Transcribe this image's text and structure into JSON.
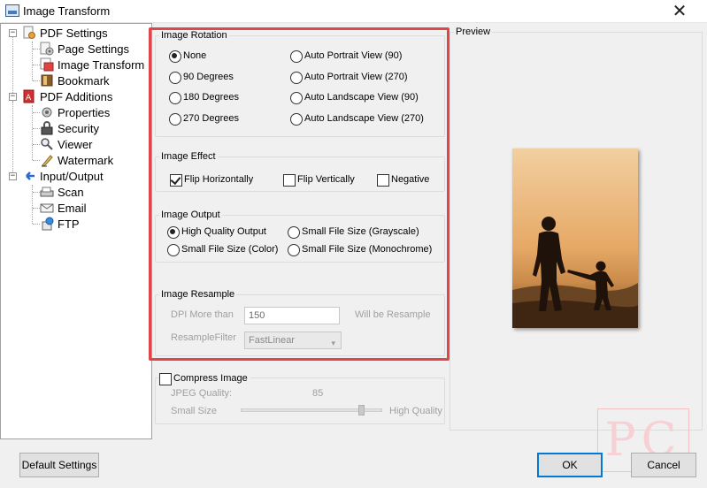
{
  "window": {
    "title": "Image Transform",
    "close_glyph": "✕"
  },
  "tree": {
    "pdf_settings": "PDF Settings",
    "page_settings": "Page Settings",
    "image_transform": "Image Transform",
    "bookmark": "Bookmark",
    "pdf_additions": "PDF Additions",
    "properties": "Properties",
    "security": "Security",
    "viewer": "Viewer",
    "watermark": "Watermark",
    "input_output": "Input/Output",
    "scan": "Scan",
    "email": "Email",
    "ftp": "FTP",
    "collapse_glyph": "−"
  },
  "rotation": {
    "label": "Image Rotation",
    "none": "None",
    "deg90": "90 Degrees",
    "deg180": "180 Degrees",
    "deg270": "270 Degrees",
    "auto_portrait_90": "Auto Portrait View (90)",
    "auto_portrait_270": "Auto Portrait View (270)",
    "auto_landscape_90": "Auto Landscape View (90)",
    "auto_landscape_270": "Auto Landscape View (270)",
    "selected": "None"
  },
  "effect": {
    "label": "Image Effect",
    "flip_h": "Flip Horizontally",
    "flip_v": "Flip Vertically",
    "negative": "Negative",
    "flip_h_checked": true,
    "flip_v_checked": false,
    "negative_checked": false
  },
  "output": {
    "label": "Image Output",
    "high_quality": "High Quality Output",
    "small_color": "Small File Size (Color)",
    "small_gray": "Small File Size (Grayscale)",
    "small_mono": "Small File Size (Monochrome)",
    "selected": "High Quality Output"
  },
  "resample": {
    "label": "Image Resample",
    "dpi_label": "DPI More than",
    "dpi_value": "150",
    "will_be": "Will be Resample",
    "filter_label": "ResampleFilter",
    "filter_value": "FastLinear",
    "arrow": "▾"
  },
  "compress": {
    "label": "Compress Image",
    "checked": false,
    "jpeg_quality_label": "JPEG Quality:",
    "jpeg_quality_value": "85",
    "small_size": "Small Size",
    "high_quality": "High Quality",
    "slider_level": 0.85
  },
  "preview": {
    "label": "Preview"
  },
  "buttons": {
    "default_settings": "Default Settings",
    "ok": "OK",
    "cancel": "Cancel"
  },
  "brand_watermark": "PC",
  "colors": {
    "highlight": "#e0454a",
    "accent": "#0078d7"
  }
}
